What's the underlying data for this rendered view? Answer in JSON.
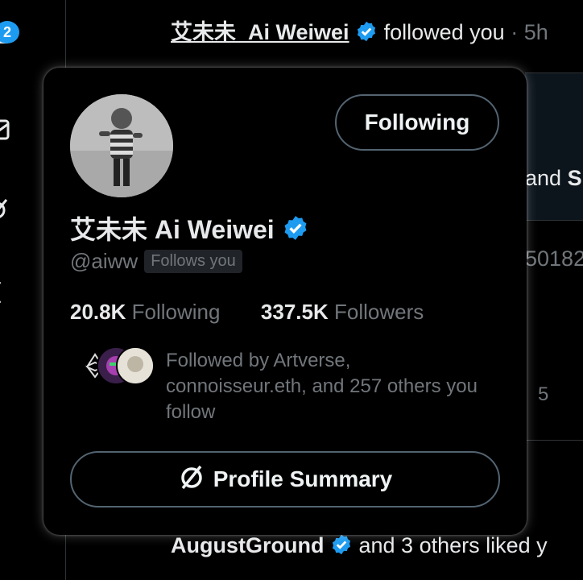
{
  "nav": {
    "notification_badge": "2"
  },
  "feed": {
    "top_notification": {
      "name": "艾未未_Ai Weiwei",
      "action": "followed you",
      "separator": " · ",
      "time": "5h"
    },
    "fragment_and": "and",
    "fragment_s": "S",
    "fragment_number": "50182",
    "fragment_count": "5",
    "bottom_notification": {
      "name": "AugustGround",
      "action": "and 3 others liked y"
    }
  },
  "hovercard": {
    "follow_button": "Following",
    "display_name": "艾未未 Ai Weiwei",
    "handle": "@aiww",
    "follows_you": "Follows you",
    "following_count": "20.8K",
    "following_label": "Following",
    "followers_count": "337.5K",
    "followers_label": "Followers",
    "followed_by": "Followed by Artverse, connoisseur.eth, and 257 others you follow",
    "summary_button": "Profile Summary",
    "summary_icon": "circle-slash-icon"
  },
  "colors": {
    "background": "#000000",
    "text": "#e7e9ea",
    "muted": "#71767b",
    "verified": "#1d9bf0",
    "border": "#536471"
  }
}
